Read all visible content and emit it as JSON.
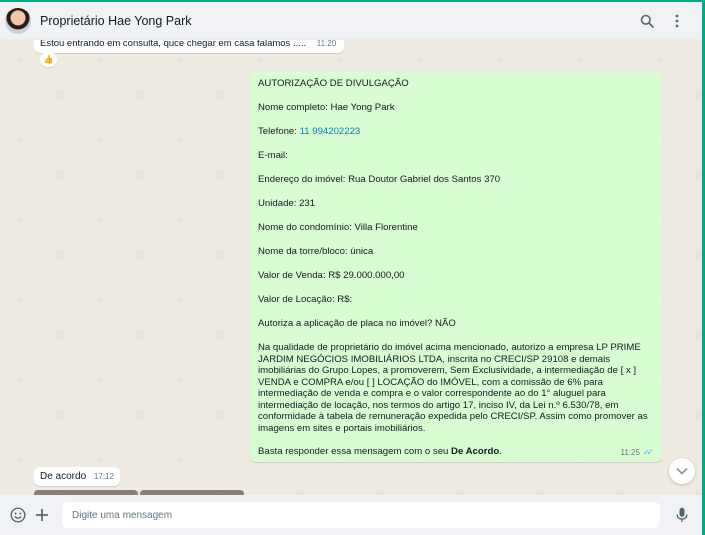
{
  "header": {
    "contact_name": "Proprietário Hae Yong Park",
    "icons": [
      "avatar",
      "search-icon",
      "menu-icon"
    ]
  },
  "messages": {
    "previous": {
      "text": "Estou entrando em consulta, quce chegar em casa falamos .....",
      "time": "11:20",
      "reaction": "👍"
    },
    "authorization": {
      "title": "AUTORIZAÇÃO DE DIVULGAÇÃO",
      "full_name": "Nome completo: Hae Yong Park",
      "phone_label": "Telefone: ",
      "phone_value": "11 994202223",
      "email": "E-mail:",
      "address": "Endereço do imóvel: Rua Doutor Gabriel dos Santos 370",
      "unit": "Unidade: 231",
      "condo": "Nome do condomínio: Villa Florentine",
      "tower": "Nome da torre/bloco: única",
      "sale_value": "Valor de Venda: R$ 29.000.000,00",
      "rent_value": "Valor de Locação: R$:",
      "sign": "Autoriza a aplicação de placa no imóvel? NÃO",
      "legal": "Na qualidade de proprietário do imóvel acima mencionado, autorizo a empresa LP PRIME JARDIM NEGÓCIOS IMOBILIÁRIOS LTDA, inscrita no CRECI/SP 29108 e demais imobiliárias do Grupo Lopes, a promoverem, Sem Exclusividade, a intermediação de [ x ] VENDA e COMPRA e/ou [ ] LOCAÇÃO do IMÓVEL, com a comissão de 6% para intermediação de venda e compra e o valor correspondente ao do 1° aluguel para intermediação de locação, nos termos do artigo 17, inciso IV, da Lei n.º 6.530/78, em conformidade à tabela de remuneração expedida pelo CRECI/SP. Assim como promover as imagens em sites e portais imobiliários.",
      "closing_prefix": "Basta responder essa mensagem com o seu ",
      "closing_bold": "De Acordo",
      "closing_suffix": ".",
      "time": "11:25"
    },
    "reply": {
      "text": "De acordo",
      "time": "17:12"
    }
  },
  "footer": {
    "placeholder": "Digite uma mensagem",
    "icons": [
      "emoji-icon",
      "plus-icon",
      "microphone-icon"
    ]
  },
  "colors": {
    "accent": "#00a884",
    "outgoing_bubble": "#d9fdd3",
    "incoming_bubble": "#ffffff",
    "chat_bg": "#efeae2",
    "header_bg": "#f0f2f5",
    "link": "#027eb5",
    "read_ticks": "#53bdeb"
  }
}
